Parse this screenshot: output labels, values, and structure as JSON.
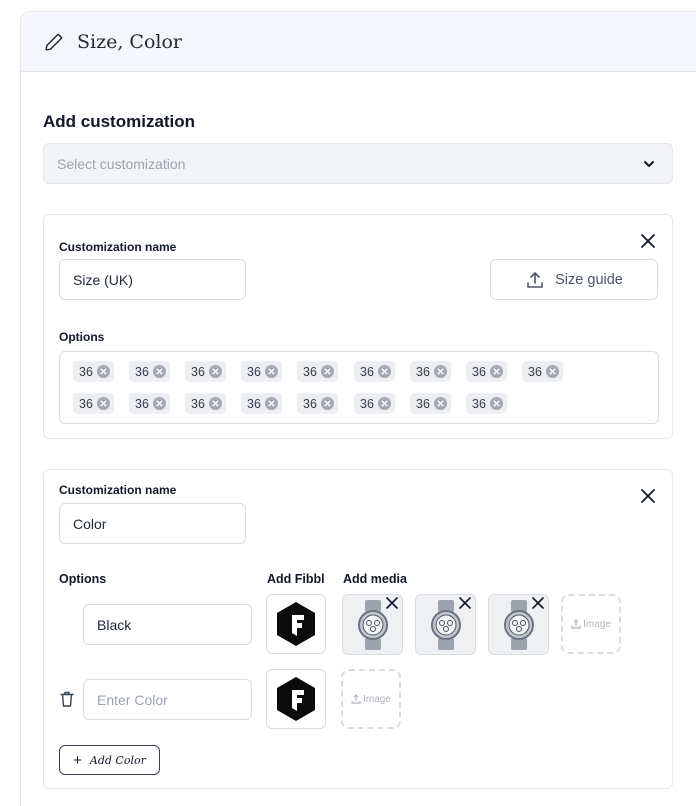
{
  "header": {
    "title": "Size, Color",
    "icon": "pencil-icon"
  },
  "add_customization": {
    "title": "Add customization",
    "select_placeholder": "Select customization"
  },
  "size_card": {
    "name_label": "Customization name",
    "name_value": "Size (UK)",
    "size_guide_label": "Size guide",
    "options_label": "Options",
    "chips_row1": [
      "36",
      "36",
      "36",
      "36",
      "36",
      "36",
      "36",
      "36",
      "36"
    ],
    "chips_row2": [
      "36",
      "36",
      "36",
      "36",
      "36",
      "36",
      "36",
      "36"
    ]
  },
  "color_card": {
    "name_label": "Customization name",
    "name_value": "Color",
    "options_label": "Options",
    "fibbl_label": "Add Fibbl",
    "media_label": "Add media",
    "option1_value": "Black",
    "option2_placeholder": "Enter Color",
    "image_label": "Image",
    "add_color_label": "Add Color"
  },
  "colors": {
    "header_bg": "#f5f7fc",
    "border": "#d9dce1",
    "chip_bg": "#eceef1"
  }
}
